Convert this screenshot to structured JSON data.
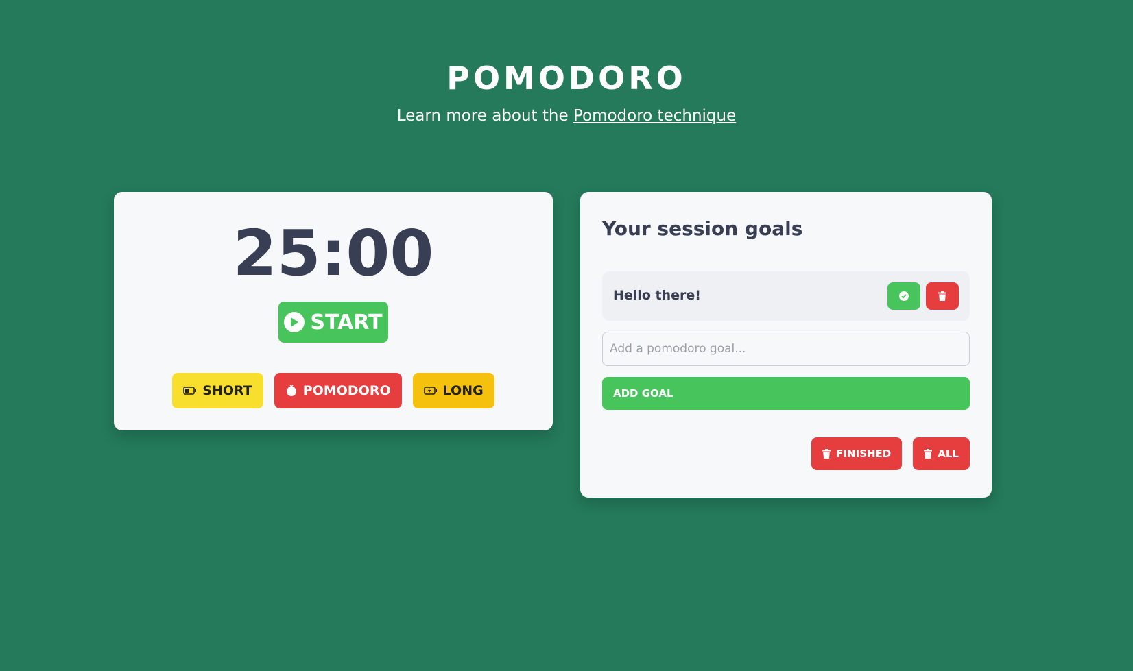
{
  "header": {
    "title": "POMODORO",
    "subtitle_prefix": "Learn more about the",
    "subtitle_link": "Pomodoro technique"
  },
  "timer": {
    "display": "25:00",
    "start_label": "START",
    "start_icon": "play-circle-icon",
    "modes": [
      {
        "label": "SHORT",
        "icon": "battery-icon",
        "color": "#f9df2d"
      },
      {
        "label": "POMODORO",
        "icon": "tomato-icon",
        "color": "#e63e3e"
      },
      {
        "label": "LONG",
        "icon": "battery-charging-icon",
        "color": "#f5c10c"
      }
    ]
  },
  "goals": {
    "title": "Your session goals",
    "items": [
      {
        "text": "Hello there!"
      }
    ],
    "input_placeholder": "Add a pomodoro goal...",
    "add_label": "ADD GOAL",
    "clear_finished_label": "FINISHED",
    "clear_all_label": "ALL"
  },
  "colors": {
    "background": "#247a5a",
    "card": "#f7f8fa",
    "green": "#48c45c",
    "red": "#e63e3e",
    "text": "#383f54"
  }
}
